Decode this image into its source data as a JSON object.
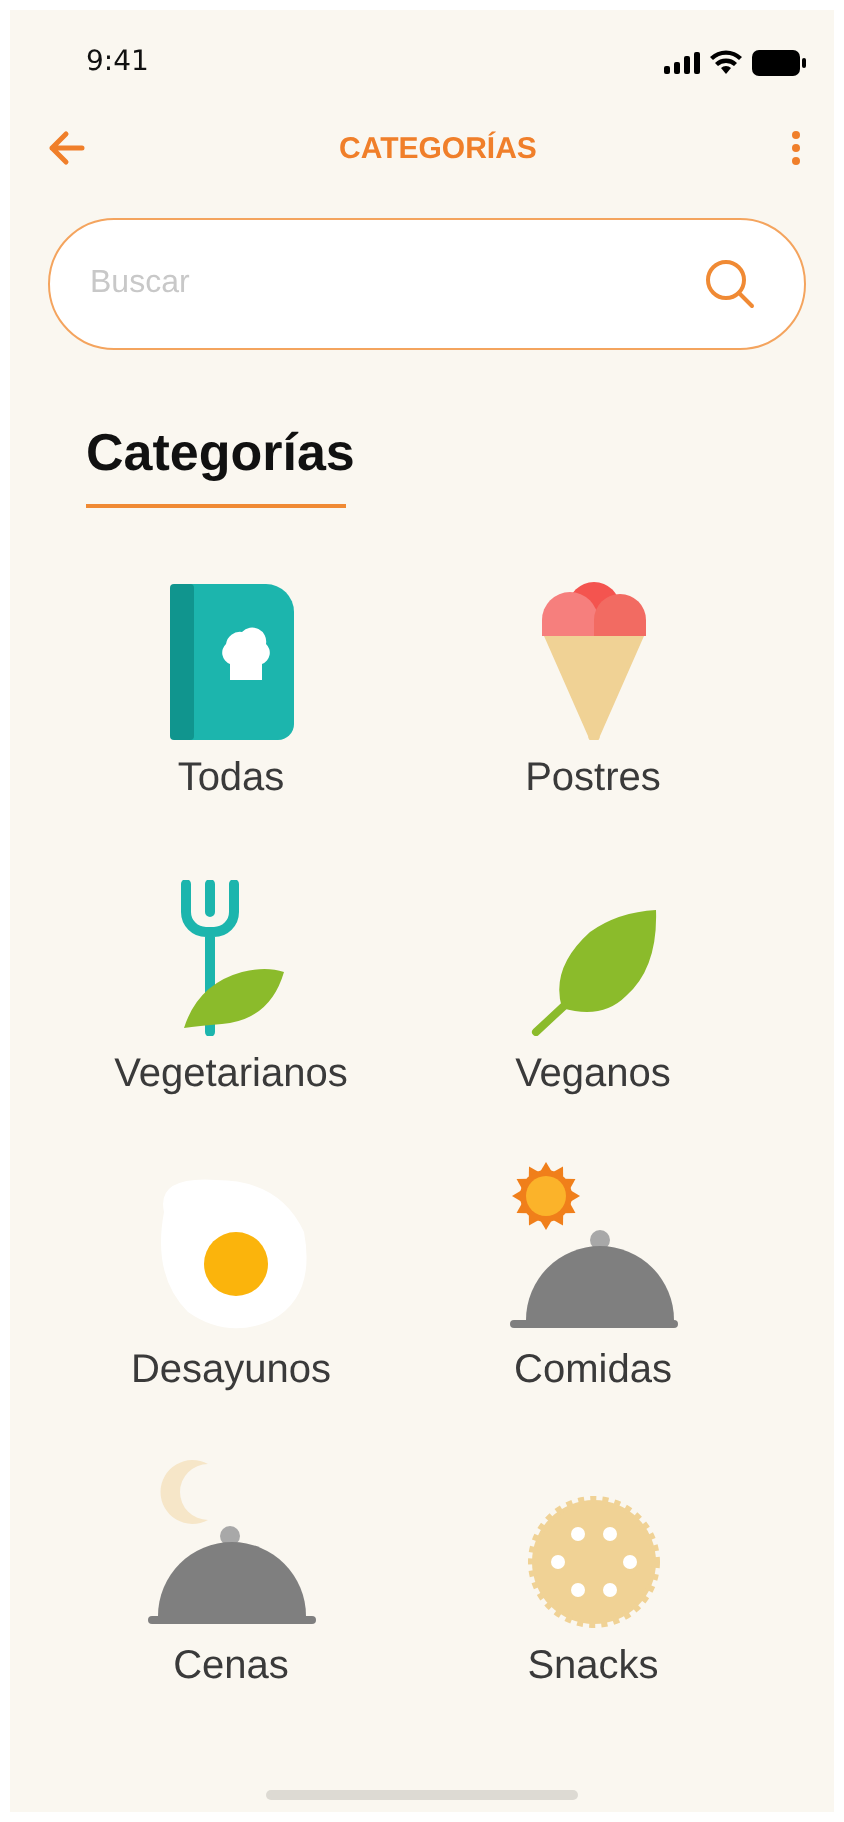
{
  "status_bar": {
    "time": "9:41"
  },
  "header": {
    "title": "CATEGORÍAS"
  },
  "search": {
    "placeholder": "Buscar"
  },
  "section_title": "Categorías",
  "categories": [
    {
      "label": "Todas",
      "kind": "book"
    },
    {
      "label": "Postres",
      "kind": "icecream"
    },
    {
      "label": "Vegetarianos",
      "kind": "forkleaf"
    },
    {
      "label": "Veganos",
      "kind": "leaf"
    },
    {
      "label": "Desayunos",
      "kind": "egg"
    },
    {
      "label": "Comidas",
      "kind": "cloche-sun"
    },
    {
      "label": "Cenas",
      "kind": "cloche-moon"
    },
    {
      "label": "Snacks",
      "kind": "cookie"
    }
  ]
}
